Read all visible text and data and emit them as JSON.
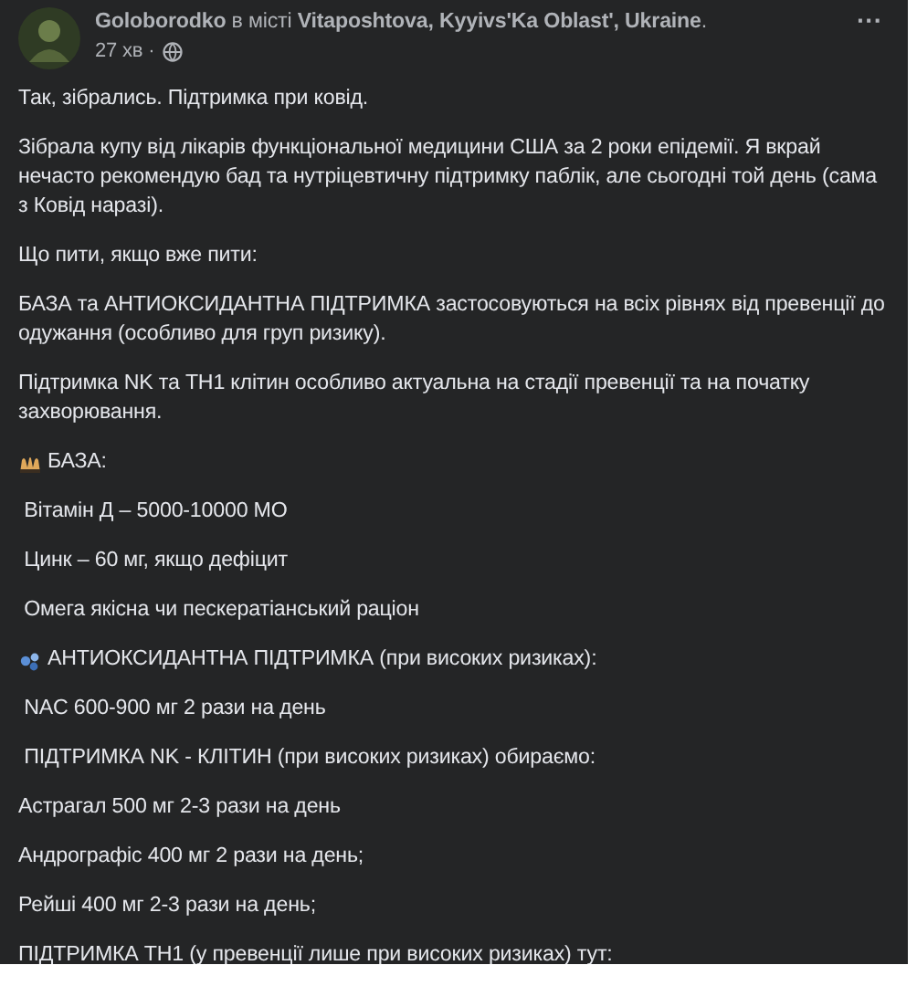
{
  "post_header": {
    "byline": "**Goloborodko** в місті **Vitaposhtova, Kyyivs'Ka Oblast', Ukraine**.",
    "time": "27 хв ·",
    "more_button": "···"
  },
  "paragraphs": [
    {
      "kind": "text",
      "text": "Так, зібрались. Підтримка при ковід."
    },
    {
      "kind": "text",
      "text": "Зібрала купу від лікарів функціональної медицини США за 2 роки епідемії. Я вкрай нечасто рекомендую бад та нутріцевтичну підтримку паблік, але сьогодні той день (сама з Ковід наразі)."
    },
    {
      "kind": "text",
      "text": "Що пити, якщо вже пити:"
    },
    {
      "kind": "text",
      "text": "БАЗА та АНТИОКСИДАНТНА ПІДТРИМКА застосовуються на всіх рівнях від превенції до одужання (особливо для груп ризику)."
    },
    {
      "kind": "text",
      "text": "Підтримка NK та ТН1 клітин особливо актуальна на стадії превенції та на початку захворювання."
    },
    {
      "kind": "hands",
      "text": "БАЗА:"
    },
    {
      "kind": "text",
      "text": " Вітамін Д – 5000-10000 МО"
    },
    {
      "kind": "text",
      "text": " Цинк – 60 мг, якщо дефіцит"
    },
    {
      "kind": "text",
      "text": " Омега якісна чи пескератіанський раціон"
    },
    {
      "kind": "drops",
      "text": "АНТИОКСИДАНТНА ПІДТРИМКА (при високих ризиках):"
    },
    {
      "kind": "text",
      "text": " NAC 600-900 мг 2 рази на день"
    },
    {
      "kind": "text",
      "text": " ПІДТРИМКА NK - КЛІТИН (при високих ризиках) обираємо:"
    },
    {
      "kind": "text",
      "text": "Астрагал 500 мг 2-3 рази на день"
    },
    {
      "kind": "text",
      "text": "Андрографіс 400 мг 2 рази на день;"
    },
    {
      "kind": "text",
      "text": "Рейші 400 мг 2-3 рази на день;"
    },
    {
      "kind": "text",
      "text": "ПІДТРИМКА ТН1 (у превенції лише при високих ризиках) тут:"
    }
  ]
}
